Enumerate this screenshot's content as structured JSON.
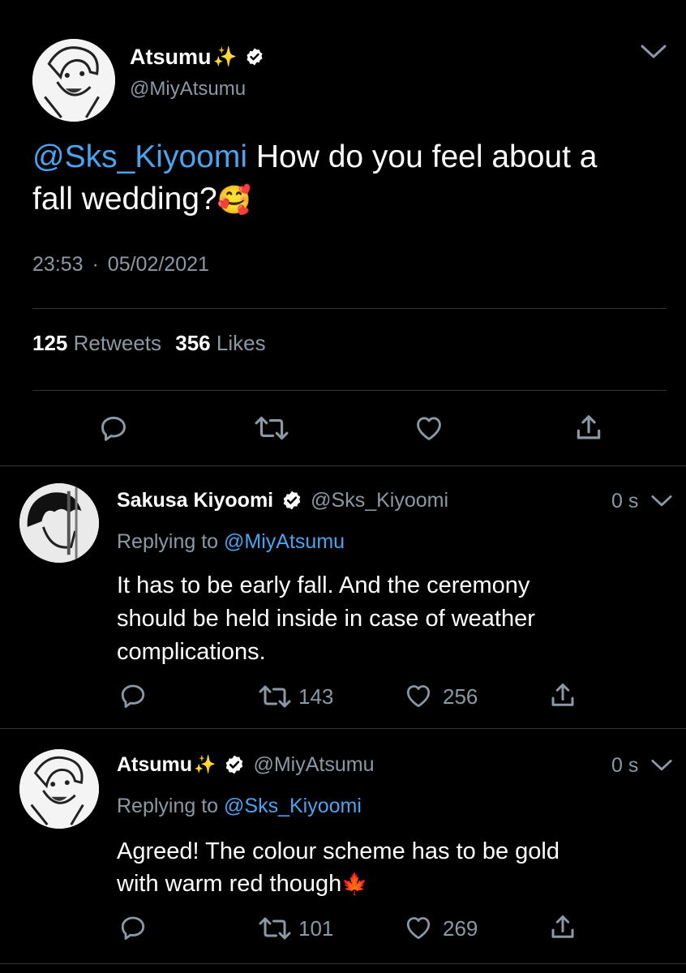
{
  "main_tweet": {
    "display_name": "Atsumu",
    "name_emoji": "✨",
    "handle": "@MiyAtsumu",
    "mention": "@Sks_Kiyoomi",
    "text_after_mention": " How do you feel about a",
    "text_line2": "fall wedding?",
    "text_emoji": "🥰",
    "time": "23:53",
    "separator": "·",
    "date": "05/02/2021",
    "retweets_count": "125",
    "retweets_label": "Retweets",
    "likes_count": "356",
    "likes_label": "Likes"
  },
  "replies": [
    {
      "display_name": "Sakusa Kiyoomi",
      "name_emoji": "",
      "handle": "@Sks_Kiyoomi",
      "time": "0 s",
      "replying_label": "Replying to",
      "replying_to": "@MiyAtsumu",
      "text_lines": [
        "It has to be early fall. And the ceremony",
        "should be held inside in case of weather",
        "complications."
      ],
      "retweets": "143",
      "likes": "256"
    },
    {
      "display_name": "Atsumu",
      "name_emoji": "✨",
      "handle": "@MiyAtsumu",
      "time": "0 s",
      "replying_label": "Replying to",
      "replying_to": "@Sks_Kiyoomi",
      "text_lines": [
        "Agreed! The colour scheme has to be gold",
        "with warm red though"
      ],
      "text_emoji": "🍁",
      "retweets": "101",
      "likes": "269"
    }
  ],
  "colors": {
    "background": "#000000",
    "link": "#4aa3ee",
    "muted": "#8b98a5",
    "divider": "#2f3336"
  },
  "icons": [
    "verified-badge-icon",
    "chevron-down-icon",
    "reply-icon",
    "retweet-icon",
    "like-icon",
    "share-icon",
    "sparkles-emoji",
    "smiling-hearts-emoji",
    "maple-leaf-emoji"
  ]
}
